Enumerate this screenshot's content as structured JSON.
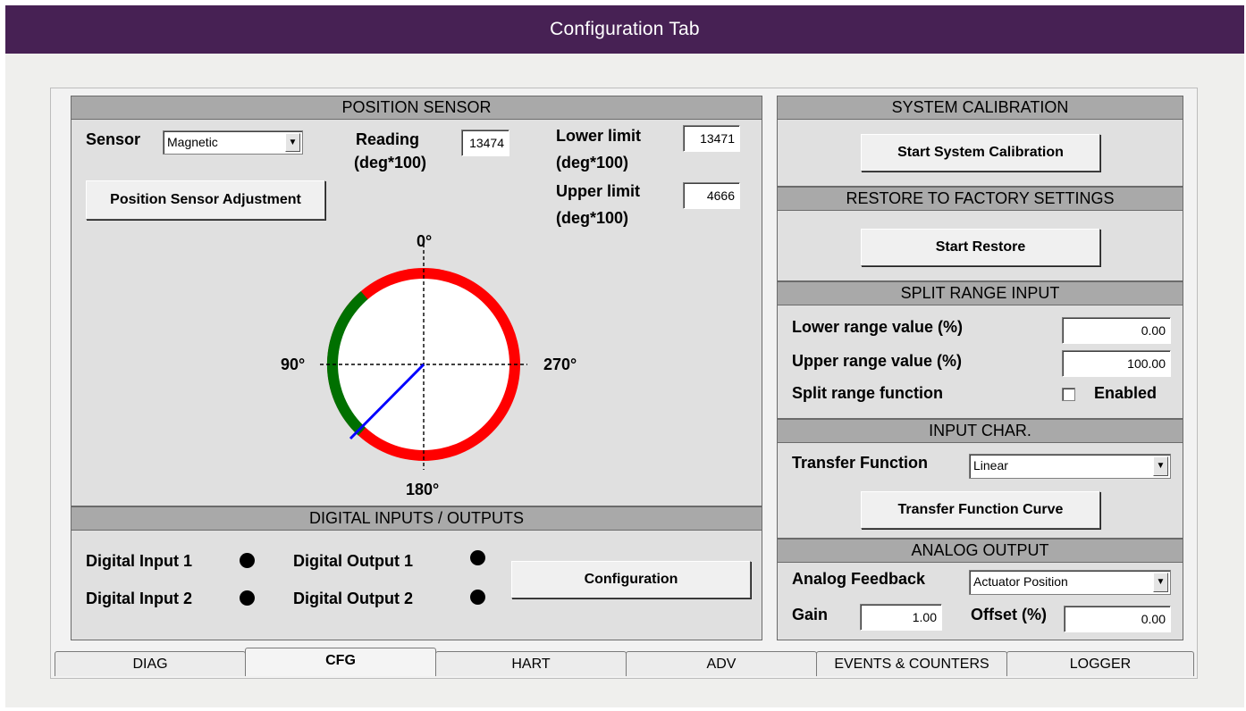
{
  "banner": {
    "title": "Configuration Tab"
  },
  "position_sensor": {
    "header": "POSITION SENSOR",
    "sensor_label": "Sensor",
    "sensor_value": "Magnetic",
    "reading_label": "Reading",
    "reading_unit": "(deg*100)",
    "reading_value": "13474",
    "lower_limit_label": "Lower limit",
    "lower_limit_unit": "(deg*100)",
    "lower_limit_value": "13471",
    "upper_limit_label": "Upper limit",
    "upper_limit_unit": "(deg*100)",
    "upper_limit_value": "4666",
    "adjust_button": "Position Sensor Adjustment",
    "dial": {
      "label_top": "0°",
      "label_left": "90°",
      "label_right": "270°",
      "label_bottom": "180°",
      "colors": {
        "ring_out": "#ff0000",
        "ring_in": "#007000",
        "needle": "#0000ff"
      }
    }
  },
  "digital_io": {
    "header": "DIGITAL INPUTS / OUTPUTS",
    "input1": "Digital Input 1",
    "input2": "Digital Input 2",
    "output1": "Digital Output 1",
    "output2": "Digital Output 2",
    "config_button": "Configuration"
  },
  "system_calibration": {
    "header": "SYSTEM CALIBRATION",
    "button": "Start System Calibration"
  },
  "restore": {
    "header": "RESTORE TO FACTORY SETTINGS",
    "button": "Start Restore"
  },
  "split_range": {
    "header": "SPLIT RANGE INPUT",
    "lower_label": "Lower range value (%)",
    "lower_value": "0.00",
    "upper_label": "Upper range value (%)",
    "upper_value": "100.00",
    "function_label": "Split range function",
    "enabled_label": "Enabled"
  },
  "input_char": {
    "header": "INPUT CHAR.",
    "transfer_label": "Transfer Function",
    "transfer_value": "Linear",
    "curve_button": "Transfer Function Curve"
  },
  "analog_output": {
    "header": "ANALOG OUTPUT",
    "feedback_label": "Analog Feedback",
    "feedback_value": "Actuator Position",
    "gain_label": "Gain",
    "gain_value": "1.00",
    "offset_label": "Offset (%)",
    "offset_value": "0.00"
  },
  "tabs": [
    "DIAG",
    "CFG",
    "HART",
    "ADV",
    "EVENTS & COUNTERS",
    "LOGGER"
  ],
  "active_tab": "CFG"
}
